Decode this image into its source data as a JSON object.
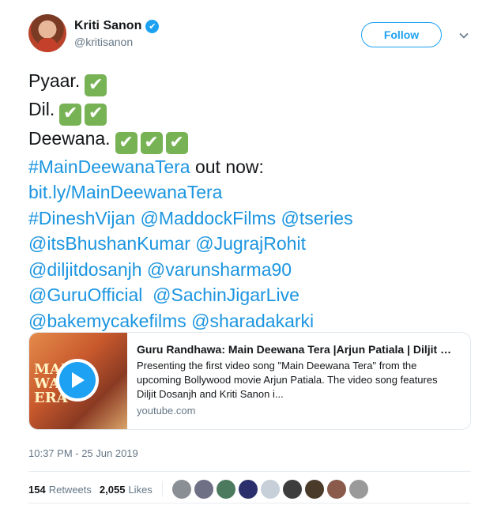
{
  "author": {
    "display_name": "Kriti Sanon",
    "handle": "@kritisanon",
    "verified_glyph": "✔"
  },
  "follow_label": "Follow",
  "tweet": {
    "line1_text": "Pyaar.",
    "line2_text": "Dil.",
    "line3_text": "Deewana.",
    "check_glyph": "✔",
    "hashtag_main": "#MainDeewanaTera",
    "out_now": " out now:",
    "short_link": "bit.ly/MainDeewanaTera",
    "mention_line1": "#DineshVijan @MaddockFilms @tseries",
    "mention_line2": "@itsBhushanKumar @JugrajRohit",
    "mention_line3": "@diljitdosanjh @varunsharma90",
    "mention_line4": "@GuruOfficial  @SachinJigarLive",
    "mention_line5": "@bakemycakefilms @sharadakarki"
  },
  "card": {
    "thumb_text_line1": "MAIN",
    "thumb_text_line2": "WAN",
    "thumb_text_line3": "ERA",
    "title": "Guru Randhawa: Main Deewana Tera |Arjun Patiala | Diljit D...",
    "description": "Presenting the first video song \"Main Deewana Tera\" from the upcoming Bollywood movie Arjun Patiala. The video song features Diljit Dosanjh and Kriti Sanon i...",
    "domain": "youtube.com"
  },
  "timestamp": "10:37 PM - 25 Jun 2019",
  "stats": {
    "retweets_count": "154",
    "retweets_label": "Retweets",
    "likes_count": "2,055",
    "likes_label": "Likes"
  },
  "colors": {
    "link": "#1b95e0",
    "accent": "#1da1f2",
    "check_green": "#77b255",
    "muted": "#657786"
  },
  "icons": [
    "verified-badge-icon",
    "chevron-down-icon",
    "check-mark-icon",
    "play-icon"
  ]
}
